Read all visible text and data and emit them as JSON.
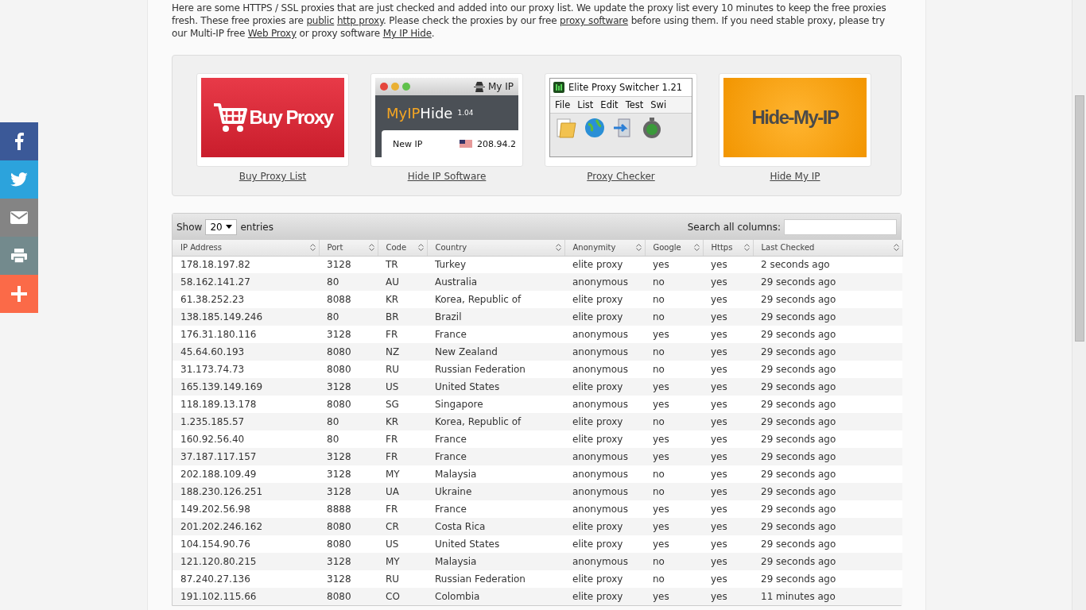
{
  "share_bar": [
    {
      "kind": "facebook",
      "color": "#3b5998"
    },
    {
      "kind": "twitter",
      "color": "#2ca3dc"
    },
    {
      "kind": "email",
      "color": "#848484"
    },
    {
      "kind": "print",
      "color": "#738a8d"
    },
    {
      "kind": "more",
      "color": "#fb6a48"
    }
  ],
  "intro": [
    {
      "kind": "text",
      "text": "Here are some HTTPS / SSL proxies that are just checked and added into our proxy list. We update the proxy list every 10 minutes to keep the free proxies fresh. These free proxies are "
    },
    {
      "kind": "link",
      "text": "public"
    },
    {
      "kind": "link",
      "text": "http proxy",
      "space_before": true
    },
    {
      "kind": "text",
      "text": ". Please check the proxies by our free "
    },
    {
      "kind": "link",
      "text": "proxy software"
    },
    {
      "kind": "text",
      "text": " before using them. If you need stable proxy, please try our Multi-IP free "
    },
    {
      "kind": "link",
      "text": "Web Proxy"
    },
    {
      "kind": "text",
      "text": " or proxy software "
    },
    {
      "kind": "link",
      "text": "My IP Hide"
    },
    {
      "kind": "text",
      "text": "."
    }
  ],
  "promos": [
    {
      "kind": "buy",
      "caption": "Buy Proxy List",
      "banner": {
        "title": "Buy Proxy"
      }
    },
    {
      "kind": "app",
      "caption": "Hide IP Software",
      "banner": {
        "window_title": "My IP",
        "brand_first": "MyIP",
        "brand_second": "Hide",
        "version": "1.04",
        "field_label": "New IP",
        "field_value": "208.94.2"
      }
    },
    {
      "kind": "switcher",
      "caption": "Proxy Checker",
      "banner": {
        "window_title": "Elite Proxy Switcher 1.21",
        "menu": [
          "File",
          "List",
          "Edit",
          "Test",
          "Swi"
        ]
      }
    },
    {
      "kind": "logo",
      "caption": "Hide My IP",
      "banner": {
        "title": "Hide-My-IP"
      }
    }
  ],
  "table": {
    "show_label": "Show",
    "page_size": "20",
    "entries_label": "entries",
    "search_label": "Search all columns:",
    "columns": [
      "IP Address",
      "Port",
      "Code",
      "Country",
      "Anonymity",
      "Google",
      "Https",
      "Last Checked"
    ],
    "rows": [
      [
        "178.18.197.82",
        "3128",
        "TR",
        "Turkey",
        "elite proxy",
        "yes",
        "yes",
        "2 seconds ago"
      ],
      [
        "58.162.141.27",
        "80",
        "AU",
        "Australia",
        "anonymous",
        "no",
        "yes",
        "29 seconds ago"
      ],
      [
        "61.38.252.23",
        "8088",
        "KR",
        "Korea, Republic of",
        "elite proxy",
        "no",
        "yes",
        "29 seconds ago"
      ],
      [
        "138.185.149.246",
        "80",
        "BR",
        "Brazil",
        "elite proxy",
        "no",
        "yes",
        "29 seconds ago"
      ],
      [
        "176.31.180.116",
        "3128",
        "FR",
        "France",
        "anonymous",
        "yes",
        "yes",
        "29 seconds ago"
      ],
      [
        "45.64.60.193",
        "8080",
        "NZ",
        "New Zealand",
        "anonymous",
        "no",
        "yes",
        "29 seconds ago"
      ],
      [
        "31.173.74.73",
        "8080",
        "RU",
        "Russian Federation",
        "anonymous",
        "no",
        "yes",
        "29 seconds ago"
      ],
      [
        "165.139.149.169",
        "3128",
        "US",
        "United States",
        "elite proxy",
        "yes",
        "yes",
        "29 seconds ago"
      ],
      [
        "118.189.13.178",
        "8080",
        "SG",
        "Singapore",
        "anonymous",
        "yes",
        "yes",
        "29 seconds ago"
      ],
      [
        "1.235.185.57",
        "80",
        "KR",
        "Korea, Republic of",
        "elite proxy",
        "no",
        "yes",
        "29 seconds ago"
      ],
      [
        "160.92.56.40",
        "80",
        "FR",
        "France",
        "elite proxy",
        "yes",
        "yes",
        "29 seconds ago"
      ],
      [
        "37.187.117.157",
        "3128",
        "FR",
        "France",
        "anonymous",
        "yes",
        "yes",
        "29 seconds ago"
      ],
      [
        "202.188.109.49",
        "3128",
        "MY",
        "Malaysia",
        "anonymous",
        "no",
        "yes",
        "29 seconds ago"
      ],
      [
        "188.230.126.251",
        "3128",
        "UA",
        "Ukraine",
        "anonymous",
        "no",
        "yes",
        "29 seconds ago"
      ],
      [
        "149.202.56.98",
        "8888",
        "FR",
        "France",
        "anonymous",
        "yes",
        "yes",
        "29 seconds ago"
      ],
      [
        "201.202.246.162",
        "8080",
        "CR",
        "Costa Rica",
        "elite proxy",
        "yes",
        "yes",
        "29 seconds ago"
      ],
      [
        "104.154.90.76",
        "8080",
        "US",
        "United States",
        "elite proxy",
        "yes",
        "yes",
        "29 seconds ago"
      ],
      [
        "121.120.80.215",
        "3128",
        "MY",
        "Malaysia",
        "anonymous",
        "no",
        "yes",
        "29 seconds ago"
      ],
      [
        "87.240.27.136",
        "3128",
        "RU",
        "Russian Federation",
        "elite proxy",
        "no",
        "yes",
        "29 seconds ago"
      ],
      [
        "191.102.115.66",
        "8080",
        "CO",
        "Colombia",
        "elite proxy",
        "yes",
        "yes",
        "11 minutes ago"
      ]
    ]
  }
}
